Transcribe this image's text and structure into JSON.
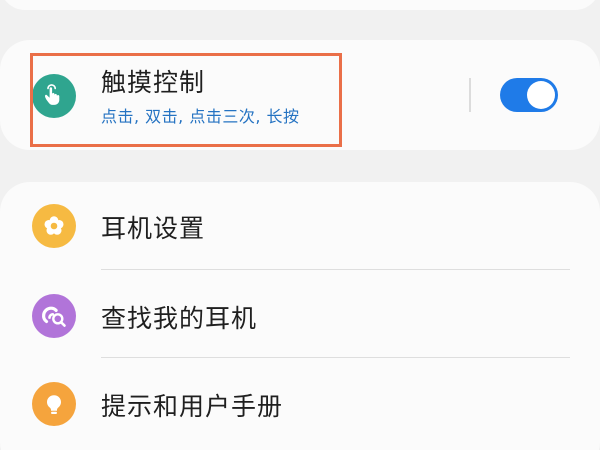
{
  "touch_control": {
    "title": "触摸控制",
    "subtitle": "点击, 双击, 点击三次, 长按",
    "enabled": true,
    "icon": "touch-hand-icon",
    "icon_color": "#2fa58f",
    "toggle_color": "#1f7be8",
    "highlight_color": "#ea6f48"
  },
  "menu": {
    "items": [
      {
        "label": "耳机设置",
        "icon": "gear-flower-icon",
        "icon_color": "#f6ba42"
      },
      {
        "label": "查找我的耳机",
        "icon": "find-earbuds-icon",
        "icon_color": "#b174d9"
      },
      {
        "label": "提示和用户手册",
        "icon": "lightbulb-icon",
        "icon_color": "#f5a43d"
      }
    ]
  }
}
